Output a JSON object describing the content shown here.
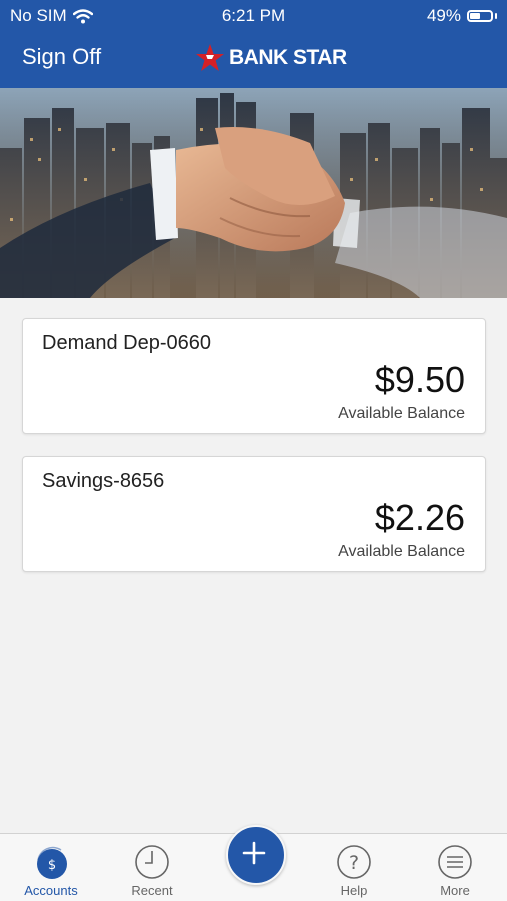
{
  "status_bar": {
    "carrier": "No SIM",
    "time": "6:21 PM",
    "battery": "49%"
  },
  "header": {
    "sign_off": "Sign Off",
    "brand": "BANK STAR"
  },
  "accounts": [
    {
      "name": "Demand Dep-0660",
      "balance": "$9.50",
      "balance_label": "Available Balance"
    },
    {
      "name": "Savings-8656",
      "balance": "$2.26",
      "balance_label": "Available Balance"
    }
  ],
  "tabs": [
    {
      "label": "Accounts",
      "icon": "dollar-icon",
      "active": true
    },
    {
      "label": "Recent",
      "icon": "clock-icon",
      "active": false
    },
    {
      "label": "",
      "icon": "plus-icon",
      "active": false
    },
    {
      "label": "Help",
      "icon": "question-icon",
      "active": false
    },
    {
      "label": "More",
      "icon": "menu-icon",
      "active": false
    }
  ],
  "colors": {
    "brand_blue": "#2357a8",
    "logo_red": "#d42027",
    "background": "#f2f2f2"
  }
}
